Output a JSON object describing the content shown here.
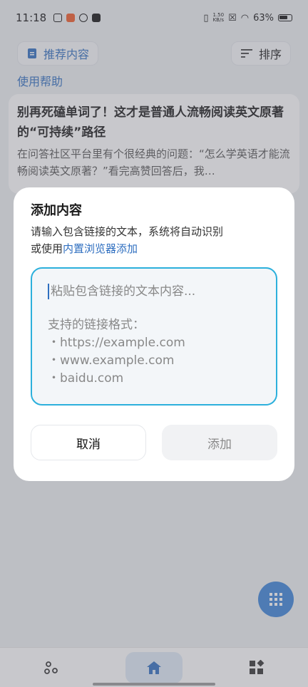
{
  "status": {
    "time": "11:18",
    "net_speed_value": "1.50",
    "net_speed_unit": "KB/s",
    "battery": "63%"
  },
  "toolbar": {
    "recommend_label": "推荐内容",
    "sort_label": "排序",
    "help_link": "使用帮助"
  },
  "article": {
    "title": "别再死磕单词了！这才是普通人流畅阅读英文原著的“可持续”路径",
    "excerpt": "在问答社区平台里有个很经典的问题：“怎么学英语才能流畅阅读英文原著？”看完高赞回答后，我…"
  },
  "dialog": {
    "title": "添加内容",
    "desc_line1": "请输入包含链接的文本，系统将自动识别",
    "desc_prefix": "或使用",
    "desc_link": "内置浏览器添加",
    "placeholder_line": "粘贴包含链接的文本内容...",
    "formats_title": "支持的链接格式：",
    "formats": [
      "・https://example.com",
      "・www.example.com",
      "・baidu.com"
    ],
    "cancel_label": "取消",
    "add_label": "添加"
  },
  "colors": {
    "accent": "#2f6fc0",
    "fab": "#3a84d8",
    "input_border": "#2cb0dc"
  }
}
